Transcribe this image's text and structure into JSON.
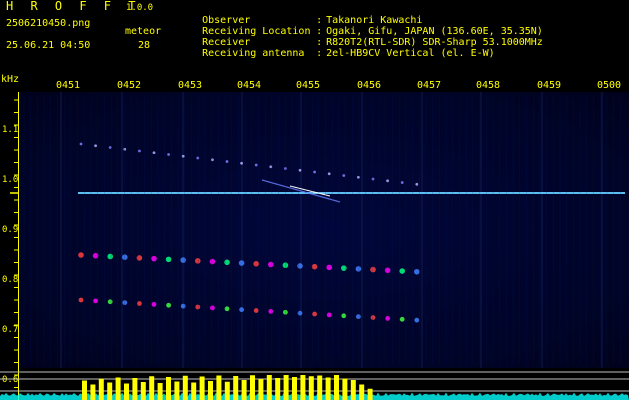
{
  "header": {
    "app_title": "H R O F F T",
    "version": "1.0.0",
    "file_name": "2506210450.png",
    "meteor_label": "meteor",
    "datetime": "25.06.21 04:50",
    "meteor_count": "28"
  },
  "info": [
    {
      "label": "Observer",
      "value": "Takanori Kawachi"
    },
    {
      "label": "Receiving Location",
      "value": "Ogaki, Gifu, JAPAN (136.60E, 35.35N)"
    },
    {
      "label": "Receiver",
      "value": "R820T2(RTL-SDR) SDR-Sharp 53.1000MHz"
    },
    {
      "label": "Receiving antenna",
      "value": "2el-HB9CV Vertical (el. E-W)"
    }
  ],
  "separator": ":",
  "axis": {
    "freq_unit": "kHz",
    "time_ticks": [
      "0451",
      "0452",
      "0453",
      "0454",
      "0455",
      "0456",
      "0457",
      "0458",
      "0459",
      "0500"
    ],
    "freq_ticks": [
      "1.1",
      "1.0",
      "0.9",
      "0.8",
      "0.7",
      "0.6"
    ]
  },
  "colors": {
    "text": "#ffff00",
    "background": "#000000",
    "spectrum_bg": "#00042a",
    "carrier": "#3ab0ff",
    "bars": "#ffff00",
    "noise": "#00ffff"
  },
  "meteor_count_bars": [
    0.78,
    0.62,
    0.85,
    0.7,
    0.9,
    0.66,
    0.88,
    0.72,
    0.95,
    0.68,
    0.92,
    0.74,
    0.97,
    0.7,
    0.94,
    0.76,
    0.98,
    0.73,
    0.96,
    0.8,
    0.99,
    0.84,
    1.0,
    0.88,
    1.0,
    0.92,
    1.0,
    0.95,
    0.98,
    0.9,
    1.0,
    0.86,
    0.8,
    0.62,
    0.45
  ]
}
